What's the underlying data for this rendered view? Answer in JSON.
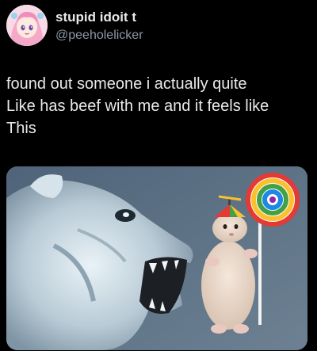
{
  "post": {
    "author": {
      "display_name": "stupid idoit t",
      "handle": "@peeholelicker",
      "avatar": "anime-girl-avatar"
    },
    "text_lines": [
      "found out someone i actually quite",
      "Like has beef with me and it feels like",
      "This"
    ],
    "media": {
      "type": "meme-image",
      "left_subject": "roaring-lioness",
      "right_subject": "hamster-with-propeller-hat-and-lollipop"
    }
  },
  "colors": {
    "background": "#000000",
    "text": "#e7e9ea",
    "secondary_text": "#8b98a5",
    "media_background": "#5c7186"
  }
}
